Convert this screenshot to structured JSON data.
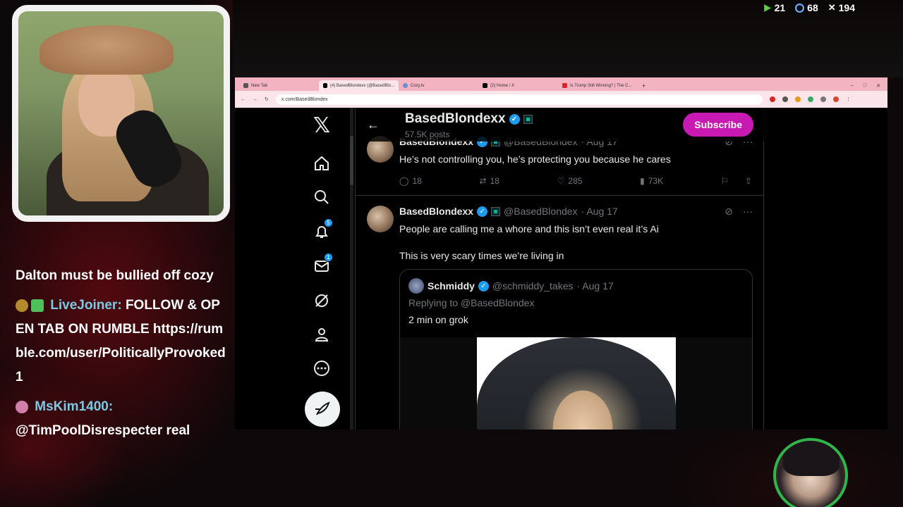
{
  "stream": {
    "stats": [
      {
        "icon": "play-icon",
        "value": "21"
      },
      {
        "icon": "thumbs-up-icon",
        "value": "68"
      },
      {
        "icon": "x-icon",
        "value": "194"
      }
    ],
    "colors": {
      "accent": "#2fb54a",
      "chat_user": "#7ec8e3",
      "subscribe": "#c81ab2"
    }
  },
  "chat": {
    "messages": [
      {
        "user": "",
        "text": "Dalton must be bullied off cozy"
      },
      {
        "user": "LiveJoiner:",
        "text": "FOLLOW & OPEN TAB ON RUMBLE https://rumble.com/user/PoliticallyProvoked1"
      },
      {
        "user": "MsKim1400:",
        "text": "@TimPoolDisrespecter real"
      }
    ]
  },
  "browser": {
    "tabs": [
      {
        "label": "New Tab"
      },
      {
        "label": "(4) BasedBlondexx (@BasedBlo..."
      },
      {
        "label": "Cozy.tv"
      },
      {
        "label": "(2) Home / X"
      },
      {
        "label": "Is Trump Still Winning? | The C..."
      }
    ],
    "url": "x.com/BasedBlondex"
  },
  "x": {
    "nav_badges": {
      "notifications": "5",
      "messages": "1"
    },
    "profile": {
      "name": "BasedBlondexx",
      "posts": "57.5K posts",
      "subscribe_label": "Subscribe"
    },
    "tweets": [
      {
        "name": "BasedBlondexx",
        "handle": "@BasedBlondex",
        "date": "· Aug 17",
        "text": "He’s not controlling you, he’s protecting you because he cares",
        "replies": "18",
        "retweets": "18",
        "likes": "285",
        "views": "73K"
      },
      {
        "name": "BasedBlondexx",
        "handle": "@BasedBlondex",
        "date": "· Aug 17",
        "text1": "People are calling me a whore and this isn’t even real it’s Ai",
        "text2": "This is very scary times we’re living in",
        "quote": {
          "name": "Schmiddy",
          "handle": "@schmiddy_takes",
          "date": "· Aug 17",
          "reply": "Replying to @BasedBlondex",
          "text": "2 min on grok"
        }
      }
    ]
  }
}
